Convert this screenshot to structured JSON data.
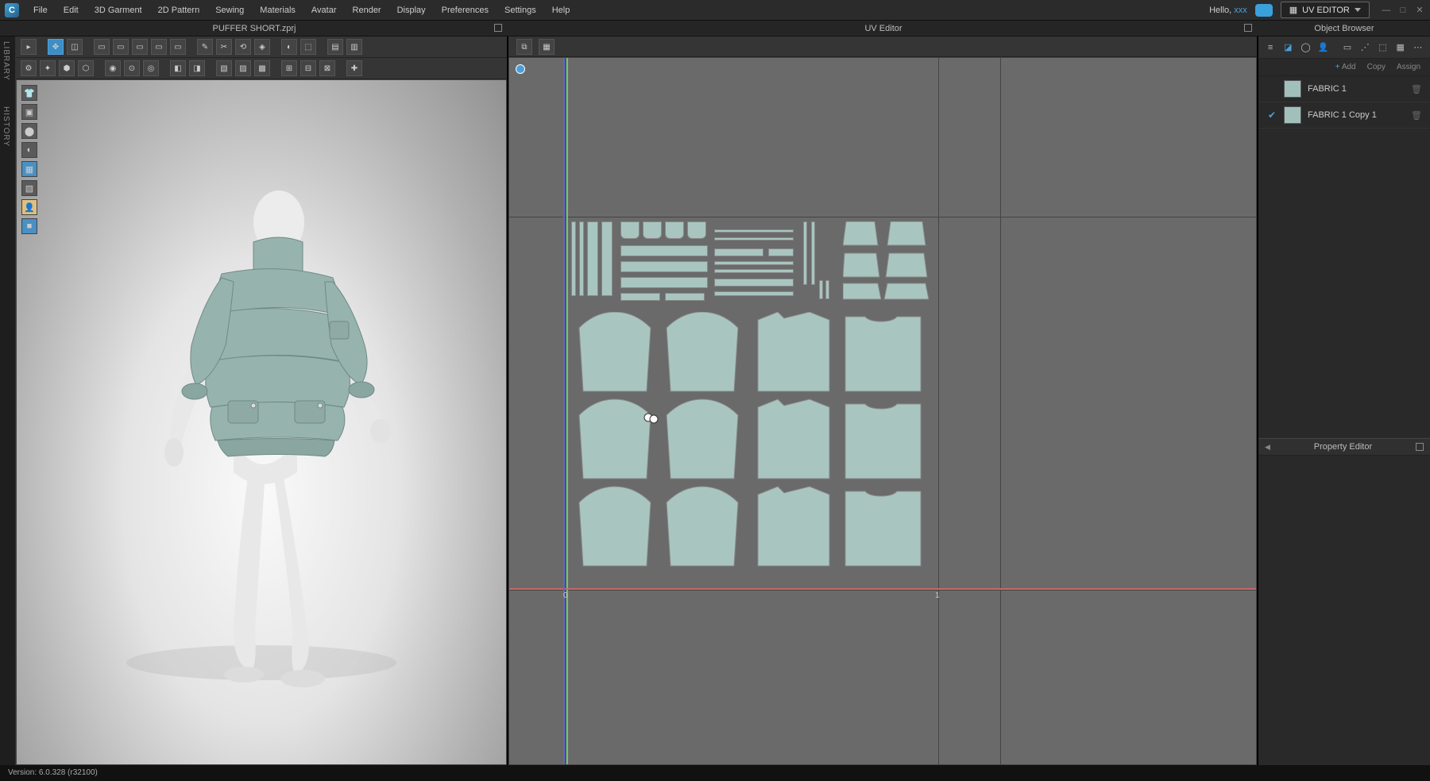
{
  "greeting": {
    "hello": "Hello,",
    "user": "xxx"
  },
  "mode": "UV EDITOR",
  "menu": [
    "File",
    "Edit",
    "3D Garment",
    "2D Pattern",
    "Sewing",
    "Materials",
    "Avatar",
    "Render",
    "Display",
    "Preferences",
    "Settings",
    "Help"
  ],
  "file_tab": "PUFFER SHORT.zprj",
  "uv_tab": "UV Editor",
  "obj_tab": "Object Browser",
  "side_library": "LIBRARY",
  "side_history": "HISTORY",
  "actions": {
    "add": "Add",
    "copy": "Copy",
    "assign": "Assign"
  },
  "fabrics": [
    {
      "checked": false,
      "name": "FABRIC 1"
    },
    {
      "checked": true,
      "name": "FABRIC 1 Copy 1"
    }
  ],
  "prop_panel": "Property Editor",
  "status": "Version: 6.0.328 (r32100)",
  "colors": {
    "fabric_swatch": "#a2c0bb",
    "accent": "#4aa0dc"
  },
  "uv": {
    "origin_label_zero": "0",
    "origin_label_one": "1"
  }
}
